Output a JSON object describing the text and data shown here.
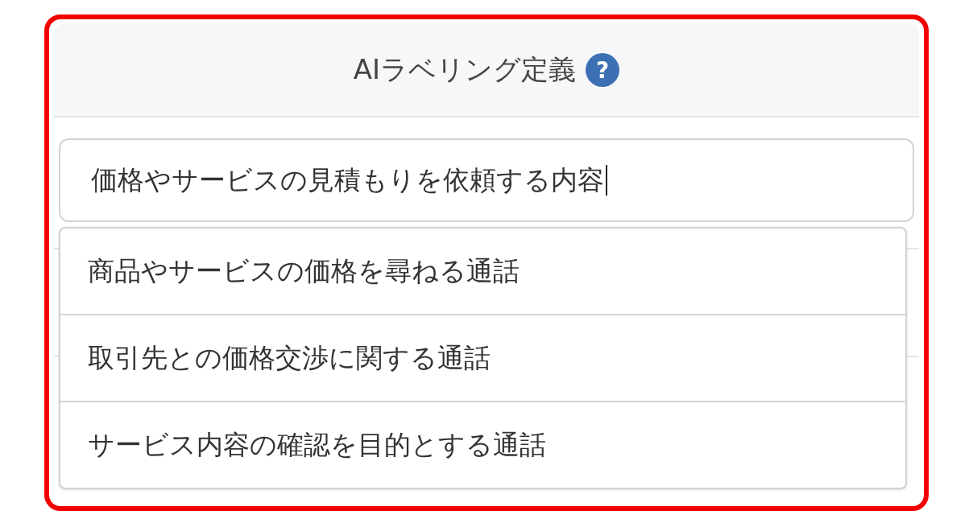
{
  "panel": {
    "title": "AIラベリング定義",
    "help_icon": "?"
  },
  "field": {
    "value": "価格やサービスの見積もりを依頼する内容",
    "focused": true
  },
  "suggestions": [
    {
      "label": "商品やサービスの価格を尋ねる通話"
    },
    {
      "label": "取引先との価格交渉に関する通話"
    },
    {
      "label": "サービス内容の確認を目的とする通話"
    }
  ]
}
